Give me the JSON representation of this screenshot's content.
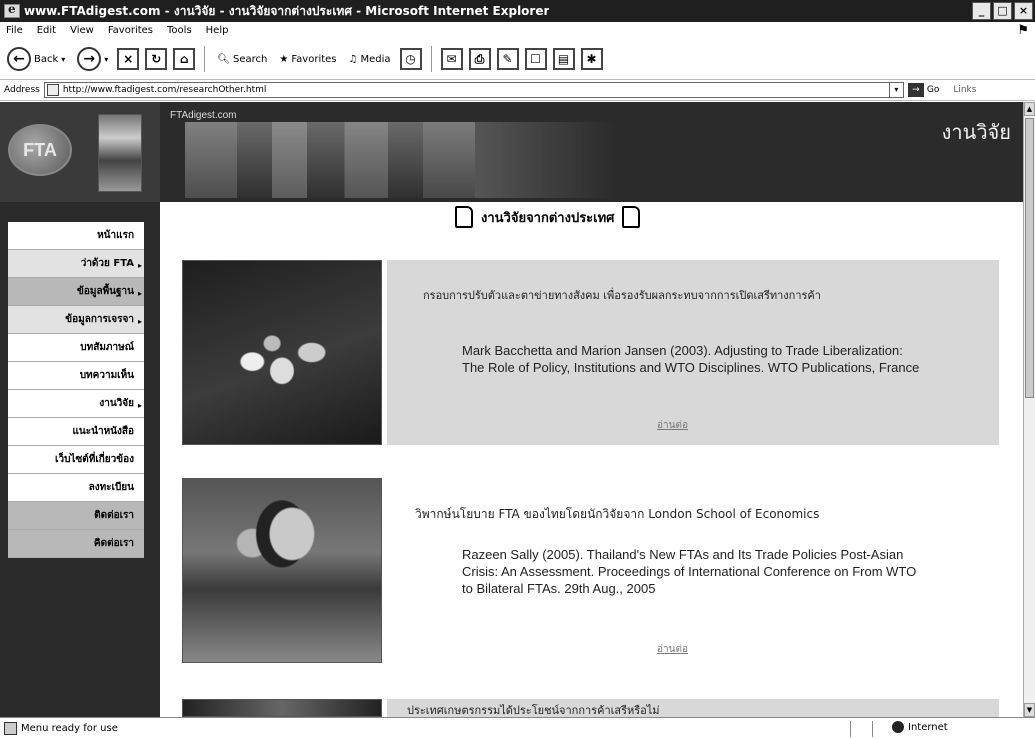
{
  "window": {
    "title": "www.FTAdigest.com - งานวิจัย - งานวิจัยจากต่างประเทศ - Microsoft Internet Explorer",
    "buttons": [
      "_",
      "□",
      "×"
    ]
  },
  "menubar": {
    "items": [
      "File",
      "Edit",
      "View",
      "Favorites",
      "Tools",
      "Help"
    ]
  },
  "toolbar": {
    "back_label": "Back",
    "search_label": "Search",
    "favorites_label": "Favorites",
    "media_label": "Media"
  },
  "address": {
    "label": "Address",
    "url": "http://www.ftadigest.com/researchOther.html",
    "go_label": "Go",
    "links_label": "Links"
  },
  "site": {
    "logo_text": "FTA",
    "site_name": "FTAdigest.com",
    "section_title": "งานวิจัย"
  },
  "nav": {
    "items": [
      {
        "label": "หน้าแรก",
        "shade": "light",
        "arrow": ""
      },
      {
        "label": "ว่าด้วย FTA",
        "shade": "mid",
        "arrow": "▸"
      },
      {
        "label": "ข้อมูลพื้นฐาน",
        "shade": "dark",
        "arrow": "▸"
      },
      {
        "label": "ข้อมูลการเจรจา",
        "shade": "mid",
        "arrow": "▸"
      },
      {
        "label": "บทสัมภาษณ์",
        "shade": "light",
        "arrow": ""
      },
      {
        "label": "บทความเห็น",
        "shade": "light",
        "arrow": ""
      },
      {
        "label": "งานวิจัย",
        "shade": "light",
        "arrow": "▸"
      },
      {
        "label": "แนะนำหนังสือ",
        "shade": "light",
        "arrow": ""
      },
      {
        "label": "เว็บไซต์ที่เกี่ยวข้อง",
        "shade": "light",
        "arrow": ""
      },
      {
        "label": "ลงทะเบียน",
        "shade": "light",
        "arrow": ""
      },
      {
        "label": "ติดต่อเรา",
        "shade": "dark",
        "arrow": ""
      },
      {
        "label": "คิดต่อเรา",
        "shade": "dark",
        "arrow": ""
      }
    ]
  },
  "content": {
    "heading": "งานวิจัยจากต่างประเทศ",
    "items": [
      {
        "title": "กรอบการปรับตัวและตาข่ายทางสังคม เพื่อรองรับผลกระทบจากการเปิดเสรีทางการค้า",
        "citation": "Mark Bacchetta and Marion Jansen (2003). Adjusting to Trade Liberalization: The Role of Policy, Institutions and WTO Disciplines. WTO Publications, France",
        "more": "อ่านต่อ"
      },
      {
        "title": "วิพากษ์นโยบาย FTA ของไทยโดยนักวิจัยจาก London School of Economics",
        "citation": "Razeen Sally (2005). Thailand's New FTAs and Its Trade Policies Post-Asian Crisis: An Assessment. Proceedings of International Conference on From WTO to Bilateral FTAs. 29th Aug., 2005",
        "more": "อ่านต่อ"
      },
      {
        "title": "ประเทศเกษตรกรรมได้ประโยชน์จากการค้าเสรีหรือไม่"
      }
    ]
  },
  "status": {
    "text": "Menu ready for use",
    "zone": "Internet"
  }
}
